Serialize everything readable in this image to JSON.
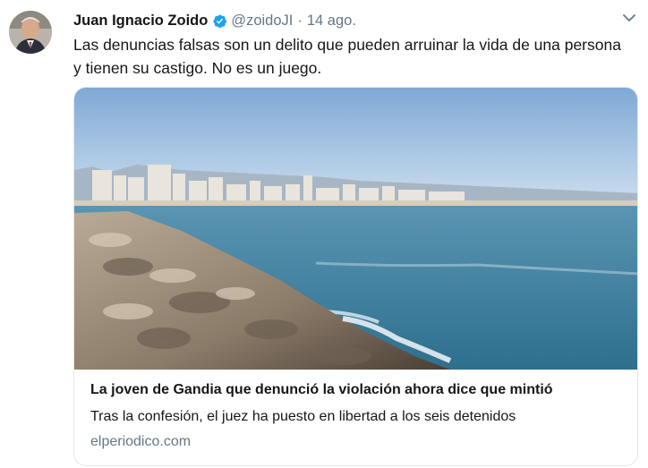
{
  "tweet": {
    "author_name": "Juan Ignacio Zoido",
    "author_handle": "@zoidoJI",
    "separator": "·",
    "timestamp": "14 ago.",
    "verified": true,
    "text_line1": "Las denuncias falsas son un delito que pueden arruinar la vida de una persona",
    "text_line2": "y tienen su castigo. No es un juego."
  },
  "card": {
    "image_description_icon": "photo-of-beach-breakwater",
    "title": "La joven de Gandia que denunció la violación ahora dice que mintió",
    "description": "Tras la confesión, el juez ha puesto en libertad a los seis detenidos",
    "domain": "elperiodico.com"
  },
  "colors": {
    "text": "#14171a",
    "secondary": "#657786",
    "verified_blue": "#1da1f2",
    "border": "#e1e8ed"
  },
  "icons": {
    "verified": "verified-badge-icon",
    "menu": "chevron-down-icon"
  }
}
